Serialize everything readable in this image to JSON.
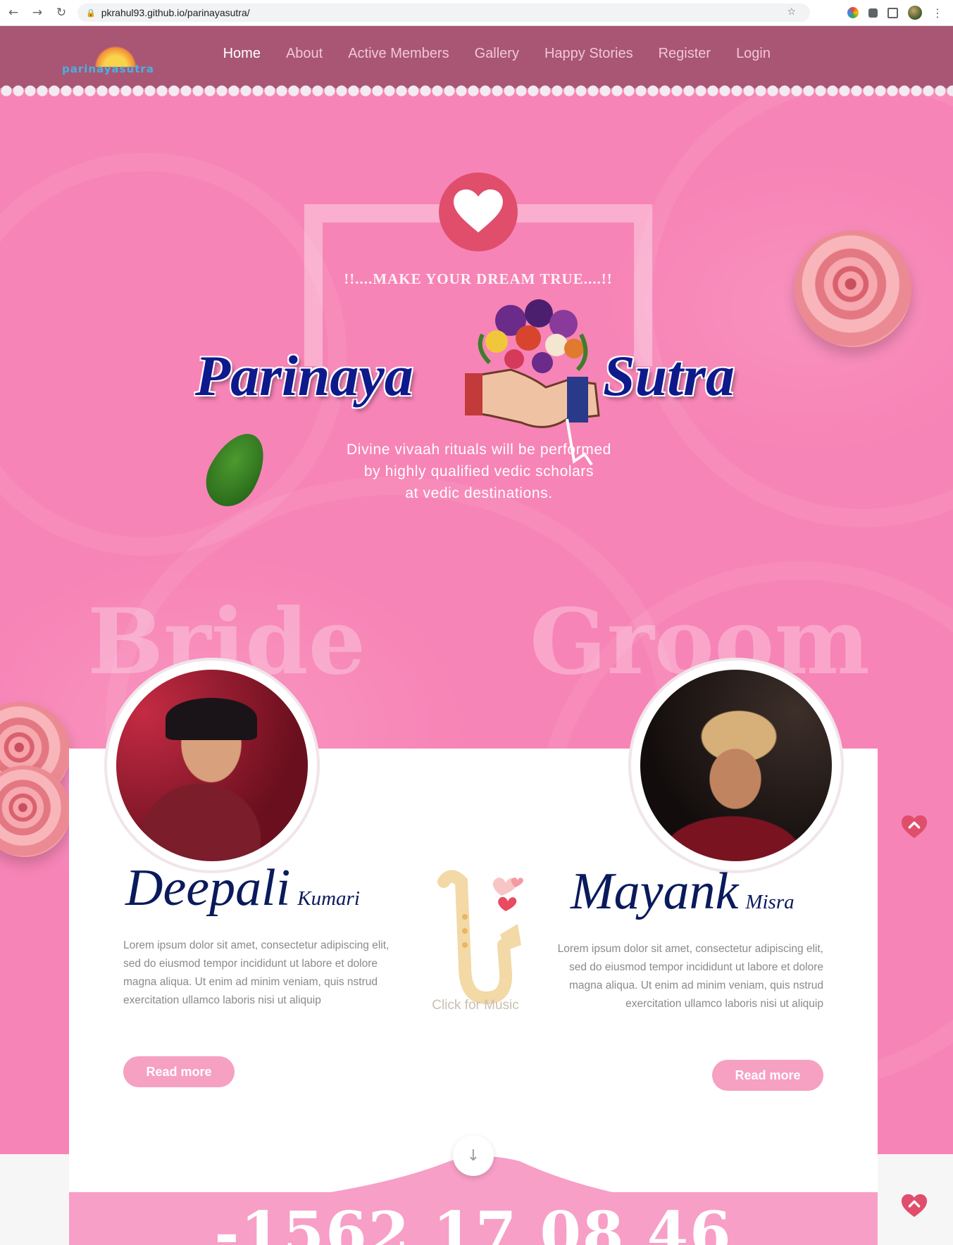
{
  "browser": {
    "url": "pkrahul93.github.io/parinayasutra/"
  },
  "site": {
    "logo_text": "parinayasutra",
    "nav": [
      {
        "label": "Home",
        "active": true
      },
      {
        "label": "About"
      },
      {
        "label": "Active Members"
      },
      {
        "label": "Gallery"
      },
      {
        "label": "Happy Stories"
      },
      {
        "label": "Register"
      },
      {
        "label": "Login"
      }
    ],
    "colors": {
      "header": "#a85674",
      "hero": "#f784b6",
      "accent": "#e04e6c",
      "name": "#0a1a5c",
      "button": "#f6a0c2"
    }
  },
  "hero": {
    "tagline": "!!....MAKE YOUR DREAM TRUE....!!",
    "brand_left": "Parinaya",
    "brand_right": "Sutra",
    "description": [
      "Divine vivaah rituals will be performed",
      "by highly qualified vedic scholars",
      "at vedic destinations."
    ]
  },
  "couple": {
    "bride_heading": "Bride",
    "groom_heading": "Groom",
    "bride": {
      "first": "Deepali",
      "last": "Kumari",
      "bio": "Lorem ipsum dolor sit amet, consectetur adipiscing elit, sed do eiusmod tempor incididunt ut labore et dolore magna aliqua. Ut enim ad minim veniam, quis nstrud exercitation ullamco laboris nisi ut aliquip",
      "button": "Read more"
    },
    "groom": {
      "first": "Mayank",
      "last": "Misra",
      "bio": "Lorem ipsum dolor sit amet, consectetur adipiscing elit, sed do eiusmod tempor incididunt ut labore et dolore magna aliqua. Ut enim ad minim veniam, quis nstrud exercitation ullamco laboris nisi ut aliquip",
      "button": "Read more"
    },
    "music_label": "Click for Music"
  },
  "counter": {
    "text": "-1562 17 08 46"
  },
  "icons": {
    "heart": "heart-icon",
    "scroll_down": "arrow-down-icon",
    "back_to_top": "heart-chevron-up-icon"
  }
}
